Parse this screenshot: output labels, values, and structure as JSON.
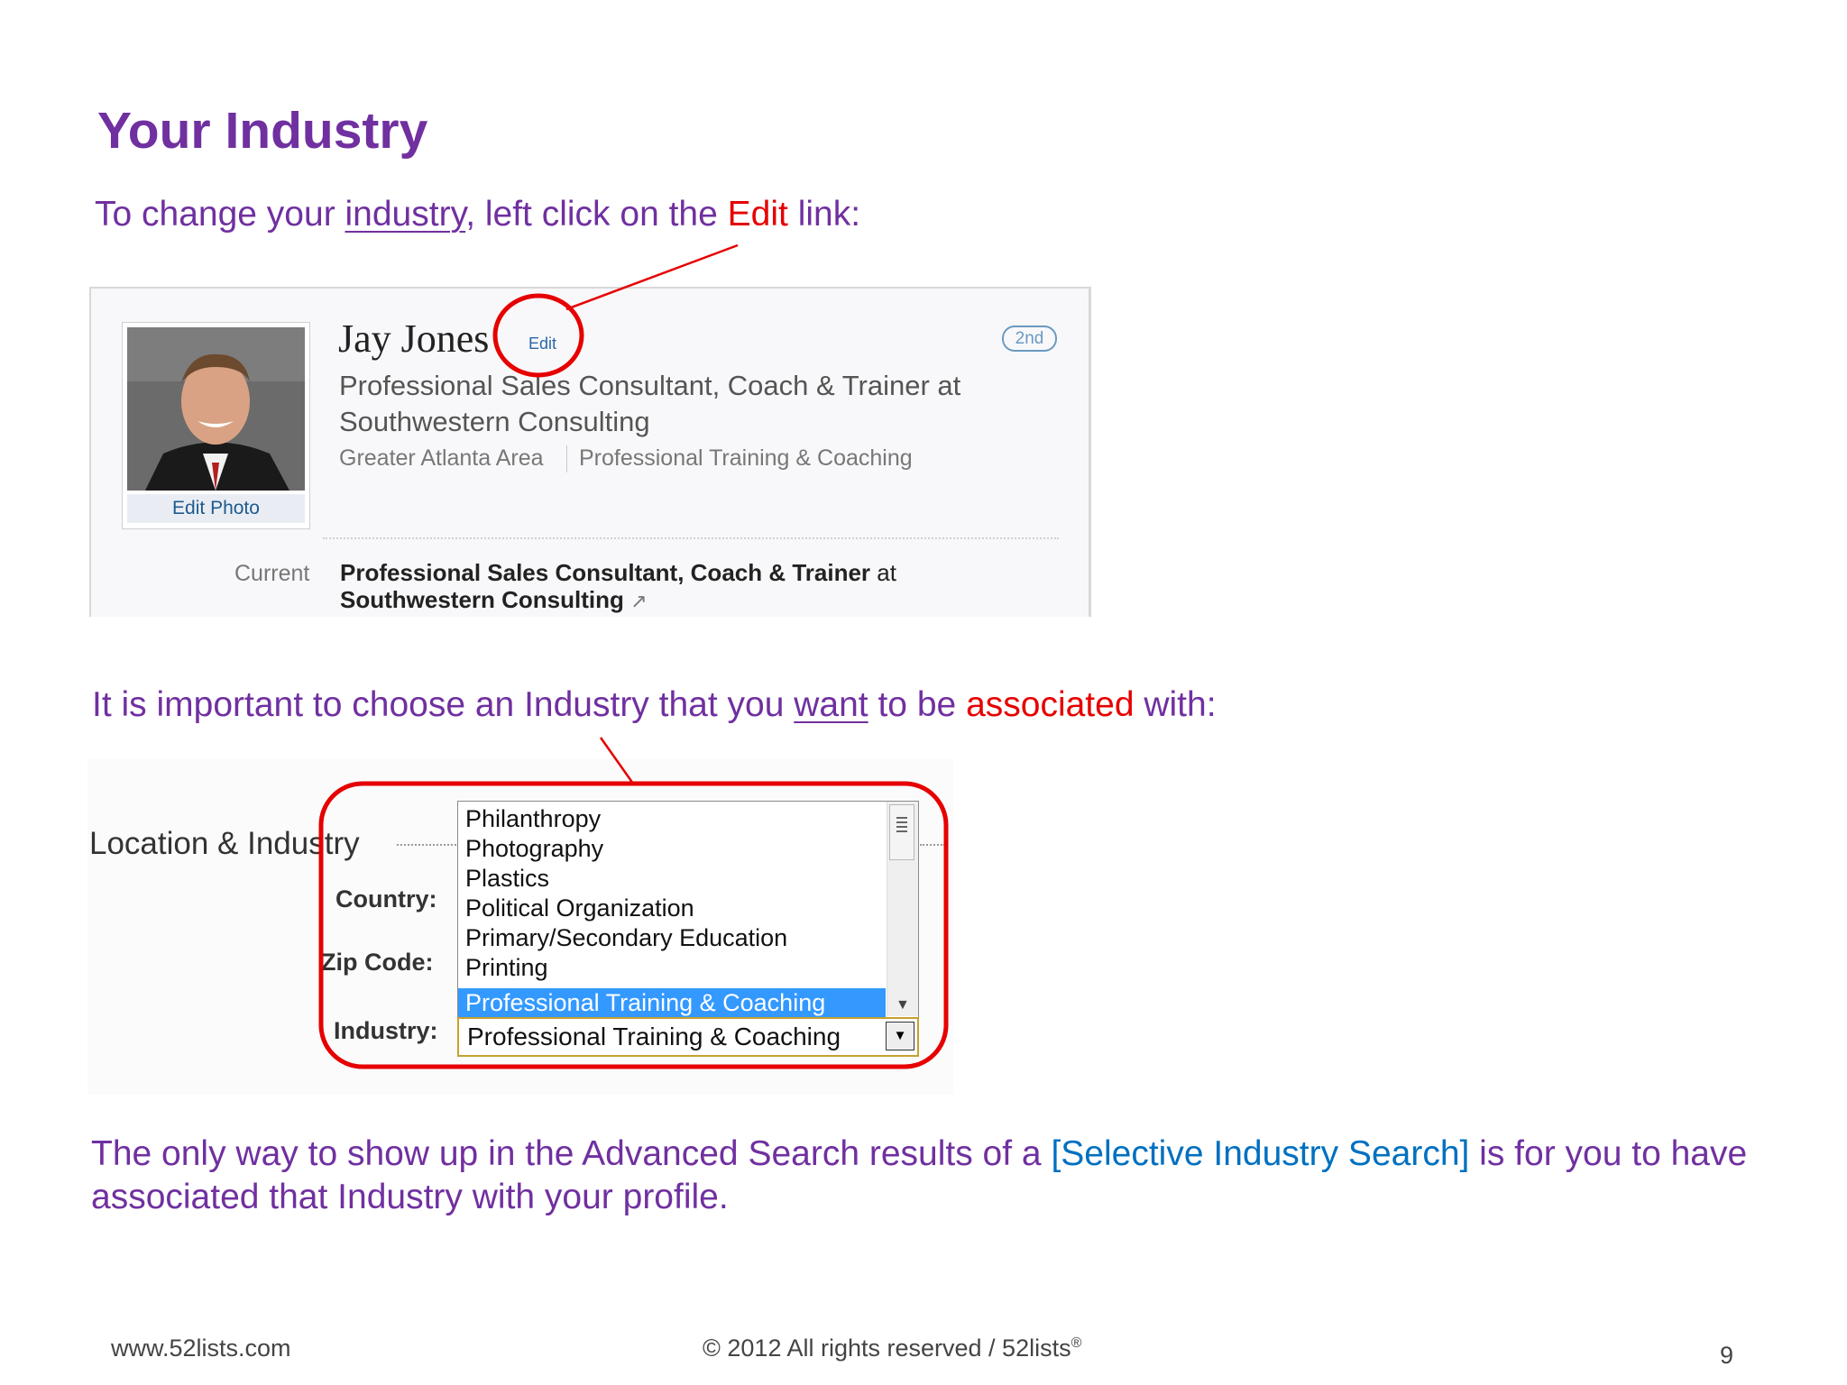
{
  "slide": {
    "title": "Your Industry",
    "line1": {
      "before": "To change your ",
      "underlined": "industry",
      "middle": ", left click on the ",
      "highlight": "Edit",
      "after": " link:"
    },
    "line2": {
      "before": "It is important to choose an Industry that you ",
      "underlined": "want",
      "middle": " to be ",
      "highlight": "associated",
      "after": " with:"
    },
    "line3": {
      "before": "The only way to show up in the Advanced Search results of a ",
      "highlight": "[Selective Industry Search]",
      "after": " is for you to have associated that Industry with your profile."
    },
    "colors": {
      "text": "#7030a0",
      "highlight_red": "#e60000",
      "highlight_blue": "#0070c0",
      "callout": "#e60000"
    }
  },
  "profile": {
    "edit_photo": "Edit Photo",
    "name": "Jay Jones",
    "edit_link": "Edit",
    "connection_badge": "2nd",
    "headline": "Professional Sales Consultant, Coach & Trainer at Southwestern Consulting",
    "location": "Greater Atlanta Area",
    "industry": "Professional Training & Coaching",
    "current_label": "Current",
    "current_title": "Professional Sales Consultant, Coach & Trainer",
    "current_at": " at",
    "current_company": "Southwestern Consulting"
  },
  "location_industry": {
    "title": "Location & Industry",
    "country_label": "Country:",
    "zip_label": "Zip Code:",
    "industry_label": "Industry:",
    "options": [
      "Philanthropy",
      "Photography",
      "Plastics",
      "Political Organization",
      "Primary/Secondary Education",
      "Printing"
    ],
    "selected_option": "Professional Training & Coaching",
    "select_value": "Professional Training & Coaching"
  },
  "footer": {
    "url": "www.52lists.com",
    "copyright": "© 2012 All rights reserved / 52lists",
    "registered": "®",
    "page_number": "9"
  }
}
